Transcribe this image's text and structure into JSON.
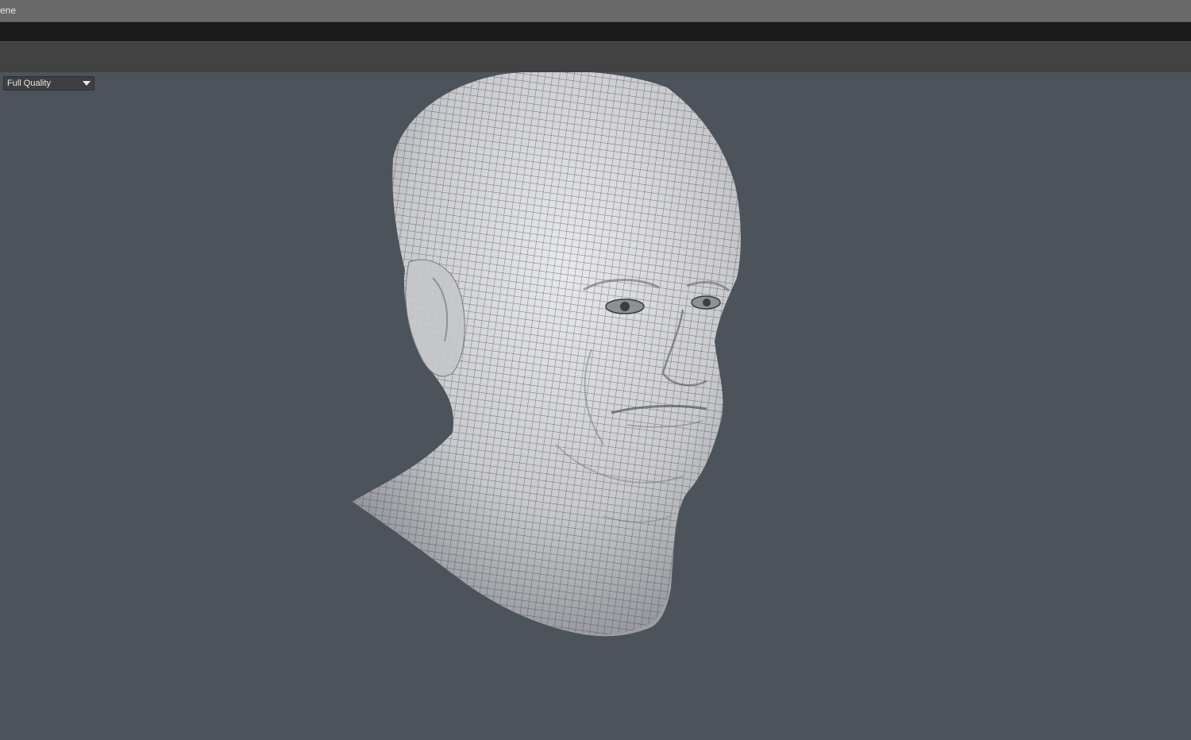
{
  "window": {
    "title": "cene"
  },
  "viewport": {
    "quality_select": {
      "value": "Full Quality",
      "icon": "chevron-down-icon"
    },
    "model": {
      "subject": "head-wireframe-mesh"
    }
  },
  "colors": {
    "viewport_bg": "#4d535b",
    "titlebar_bg": "#6a6a6a",
    "menubar_bg": "#1b1b1b",
    "toolbar_bg": "#424242",
    "mesh_surface": "#d9dadd",
    "mesh_wire": "#3a3b3e"
  }
}
